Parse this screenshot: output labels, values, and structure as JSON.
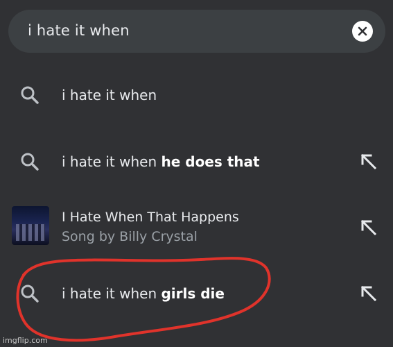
{
  "search": {
    "query": "i hate it when"
  },
  "suggestions": [
    {
      "prefix": "i hate it when",
      "completion": ""
    },
    {
      "prefix": "i hate it when ",
      "completion": "he does that"
    },
    {
      "title": "I Hate When That Happens",
      "subtitle": "Song by Billy Crystal"
    },
    {
      "prefix": "i hate it when ",
      "completion": "girls die"
    }
  ],
  "watermark": "imgflip.com",
  "colors": {
    "background": "#303134",
    "search_bar": "#3c4043",
    "text": "#e8eaed",
    "muted": "#9aa0a6",
    "annotation": "#e0332b"
  }
}
